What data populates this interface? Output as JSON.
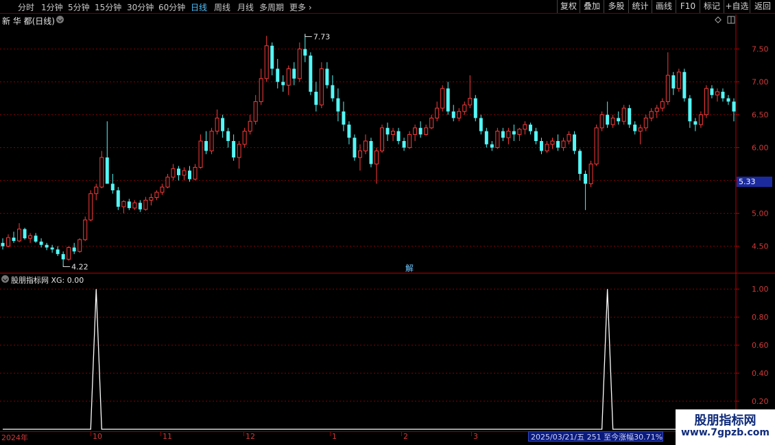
{
  "toolbar": {
    "tabs": [
      "分时",
      "1分钟",
      "5分钟",
      "15分钟",
      "30分钟",
      "60分钟",
      "日线",
      "周线",
      "月线",
      "多周期",
      "更多"
    ],
    "right_buttons": [
      "复权",
      "叠加",
      "多股",
      "统计",
      "画线",
      "F10",
      "标记",
      "+自选",
      "返回"
    ]
  },
  "stock": {
    "title": "新 华 都(日线)"
  },
  "main_chart": {
    "high_label": "7.73",
    "low_label": "4.22",
    "current_price": "5.33",
    "marker": "解",
    "y_ticks": [
      "7.50",
      "7.00",
      "6.50",
      "6.00",
      "5.50",
      "5.00",
      "4.50"
    ]
  },
  "indicator": {
    "title": "股朋指标网 XG: 0.00",
    "y_ticks": [
      "1.00",
      "0.80",
      "0.60",
      "0.40",
      "0.20"
    ]
  },
  "x_axis": {
    "ticks": [
      "2024年",
      "10",
      "11",
      "12",
      "1",
      "2",
      "3"
    ]
  },
  "status_bar": {
    "text": "2025/03/21/五 251 至今涨幅30.71%"
  },
  "watermark": {
    "title": "股朋指标网",
    "url": "www.7gpzb.com"
  },
  "colors": {
    "up": "#ff3b3b",
    "down": "#54f7f7",
    "grid": "#8b0000",
    "axis": "#c00000"
  },
  "chart_data": {
    "type": "candlestick",
    "title": "新 华 都(日线)",
    "y_range": [
      4.1,
      7.85
    ],
    "ohlc": [
      [
        4.55,
        4.62,
        4.45,
        4.5
      ],
      [
        4.5,
        4.68,
        4.48,
        4.63
      ],
      [
        4.63,
        4.72,
        4.55,
        4.58
      ],
      [
        4.58,
        4.85,
        4.56,
        4.76
      ],
      [
        4.76,
        4.78,
        4.6,
        4.62
      ],
      [
        4.62,
        4.7,
        4.55,
        4.66
      ],
      [
        4.66,
        4.7,
        4.55,
        4.57
      ],
      [
        4.57,
        4.62,
        4.48,
        4.52
      ],
      [
        4.52,
        4.55,
        4.44,
        4.48
      ],
      [
        4.48,
        4.52,
        4.4,
        4.45
      ],
      [
        4.45,
        4.5,
        4.35,
        4.38
      ],
      [
        4.38,
        4.42,
        4.22,
        4.3
      ],
      [
        4.3,
        4.5,
        4.28,
        4.48
      ],
      [
        4.48,
        4.55,
        4.38,
        4.42
      ],
      [
        4.42,
        4.62,
        4.4,
        4.6
      ],
      [
        4.6,
        4.95,
        4.58,
        4.9
      ],
      [
        4.9,
        5.35,
        4.88,
        5.3
      ],
      [
        5.3,
        5.45,
        5.2,
        5.4
      ],
      [
        5.4,
        5.95,
        5.38,
        5.85
      ],
      [
        5.85,
        6.4,
        5.78,
        5.45
      ],
      [
        5.45,
        5.6,
        5.3,
        5.35
      ],
      [
        5.35,
        5.4,
        5.05,
        5.1
      ],
      [
        5.1,
        5.2,
        5.0,
        5.18
      ],
      [
        5.18,
        5.22,
        5.05,
        5.08
      ],
      [
        5.08,
        5.2,
        5.05,
        5.16
      ],
      [
        5.16,
        5.2,
        5.02,
        5.06
      ],
      [
        5.06,
        5.25,
        5.04,
        5.2
      ],
      [
        5.2,
        5.3,
        5.12,
        5.24
      ],
      [
        5.24,
        5.35,
        5.2,
        5.32
      ],
      [
        5.32,
        5.45,
        5.28,
        5.4
      ],
      [
        5.4,
        5.6,
        5.38,
        5.55
      ],
      [
        5.55,
        5.75,
        5.5,
        5.68
      ],
      [
        5.68,
        5.72,
        5.5,
        5.58
      ],
      [
        5.58,
        5.7,
        5.5,
        5.65
      ],
      [
        5.65,
        5.72,
        5.48,
        5.52
      ],
      [
        5.52,
        5.75,
        5.5,
        5.7
      ],
      [
        5.7,
        6.2,
        5.68,
        6.1
      ],
      [
        6.1,
        6.25,
        5.9,
        5.95
      ],
      [
        5.95,
        6.3,
        5.9,
        6.25
      ],
      [
        6.25,
        6.58,
        6.2,
        6.45
      ],
      [
        6.45,
        6.5,
        6.15,
        6.25
      ],
      [
        6.25,
        6.3,
        6.0,
        6.1
      ],
      [
        6.1,
        6.2,
        5.8,
        5.85
      ],
      [
        5.85,
        6.1,
        5.68,
        6.05
      ],
      [
        6.05,
        6.3,
        6.0,
        6.25
      ],
      [
        6.25,
        6.5,
        6.2,
        6.4
      ],
      [
        6.4,
        6.8,
        6.35,
        6.7
      ],
      [
        6.7,
        7.2,
        6.65,
        7.05
      ],
      [
        7.05,
        7.7,
        7.0,
        7.55
      ],
      [
        7.55,
        7.6,
        7.1,
        7.2
      ],
      [
        7.2,
        7.35,
        6.9,
        7.0
      ],
      [
        7.0,
        7.1,
        6.85,
        6.95
      ],
      [
        6.95,
        7.25,
        6.8,
        7.2
      ],
      [
        7.2,
        7.3,
        6.95,
        7.05
      ],
      [
        7.05,
        7.6,
        7.0,
        7.5
      ],
      [
        7.5,
        7.73,
        7.3,
        7.4
      ],
      [
        7.4,
        7.45,
        6.8,
        6.85
      ],
      [
        6.85,
        7.0,
        6.55,
        6.65
      ],
      [
        6.65,
        7.3,
        6.6,
        7.2
      ],
      [
        7.2,
        7.3,
        6.9,
        6.95
      ],
      [
        6.95,
        7.1,
        6.7,
        6.75
      ],
      [
        6.75,
        6.9,
        6.4,
        6.55
      ],
      [
        6.55,
        6.7,
        6.25,
        6.35
      ],
      [
        6.35,
        6.4,
        6.05,
        6.15
      ],
      [
        6.15,
        6.2,
        5.8,
        5.85
      ],
      [
        5.85,
        6.05,
        5.65,
        5.95
      ],
      [
        5.95,
        6.2,
        5.9,
        6.1
      ],
      [
        6.1,
        6.15,
        5.7,
        5.75
      ],
      [
        5.75,
        6.0,
        5.45,
        5.95
      ],
      [
        5.95,
        6.35,
        5.92,
        6.3
      ],
      [
        6.3,
        6.38,
        6.1,
        6.2
      ],
      [
        6.2,
        6.3,
        6.1,
        6.25
      ],
      [
        6.25,
        6.3,
        6.05,
        6.1
      ],
      [
        6.1,
        6.15,
        5.95,
        6.0
      ],
      [
        6.0,
        6.25,
        5.98,
        6.2
      ],
      [
        6.2,
        6.35,
        6.1,
        6.3
      ],
      [
        6.3,
        6.4,
        6.15,
        6.2
      ],
      [
        6.2,
        6.35,
        6.18,
        6.3
      ],
      [
        6.3,
        6.5,
        6.28,
        6.45
      ],
      [
        6.45,
        6.7,
        6.4,
        6.6
      ],
      [
        6.6,
        6.95,
        6.55,
        6.9
      ],
      [
        6.9,
        7.0,
        6.5,
        6.55
      ],
      [
        6.55,
        6.65,
        6.4,
        6.45
      ],
      [
        6.45,
        6.6,
        6.4,
        6.55
      ],
      [
        6.55,
        6.7,
        6.5,
        6.65
      ],
      [
        6.65,
        7.1,
        6.6,
        6.75
      ],
      [
        6.75,
        6.8,
        6.4,
        6.45
      ],
      [
        6.45,
        6.5,
        6.2,
        6.25
      ],
      [
        6.25,
        6.3,
        6.0,
        6.05
      ],
      [
        6.05,
        6.1,
        5.95,
        6.0
      ],
      [
        6.0,
        6.3,
        5.98,
        6.25
      ],
      [
        6.25,
        6.3,
        6.1,
        6.15
      ],
      [
        6.15,
        6.3,
        6.05,
        6.25
      ],
      [
        6.25,
        6.35,
        6.1,
        6.2
      ],
      [
        6.2,
        6.3,
        6.1,
        6.28
      ],
      [
        6.28,
        6.4,
        6.2,
        6.35
      ],
      [
        6.35,
        6.38,
        6.2,
        6.25
      ],
      [
        6.25,
        6.3,
        6.05,
        6.1
      ],
      [
        6.1,
        6.15,
        5.9,
        5.95
      ],
      [
        5.95,
        6.1,
        5.92,
        6.05
      ],
      [
        6.05,
        6.15,
        5.98,
        6.1
      ],
      [
        6.1,
        6.2,
        5.95,
        6.0
      ],
      [
        6.0,
        6.15,
        5.95,
        6.1
      ],
      [
        6.1,
        6.25,
        6.05,
        6.2
      ],
      [
        6.2,
        6.25,
        5.9,
        5.95
      ],
      [
        5.95,
        5.98,
        5.5,
        5.6
      ],
      [
        5.6,
        5.65,
        5.05,
        5.45
      ],
      [
        5.45,
        5.8,
        5.4,
        5.75
      ],
      [
        5.75,
        6.35,
        5.72,
        6.3
      ],
      [
        6.3,
        6.55,
        6.25,
        6.5
      ],
      [
        6.5,
        6.7,
        6.3,
        6.35
      ],
      [
        6.35,
        6.5,
        6.3,
        6.45
      ],
      [
        6.45,
        6.55,
        6.35,
        6.4
      ],
      [
        6.4,
        6.65,
        6.35,
        6.6
      ],
      [
        6.6,
        6.65,
        6.3,
        6.35
      ],
      [
        6.35,
        6.4,
        6.2,
        6.25
      ],
      [
        6.25,
        6.35,
        6.05,
        6.3
      ],
      [
        6.3,
        6.5,
        6.25,
        6.45
      ],
      [
        6.45,
        6.6,
        6.4,
        6.55
      ],
      [
        6.55,
        6.65,
        6.45,
        6.6
      ],
      [
        6.6,
        6.75,
        6.55,
        6.7
      ],
      [
        6.7,
        7.45,
        6.65,
        7.1
      ],
      [
        7.1,
        7.15,
        6.8,
        6.9
      ],
      [
        6.9,
        7.2,
        6.85,
        7.15
      ],
      [
        7.15,
        7.2,
        6.7,
        6.75
      ],
      [
        6.75,
        6.8,
        6.3,
        6.4
      ],
      [
        6.4,
        6.45,
        6.25,
        6.35
      ],
      [
        6.35,
        6.55,
        6.3,
        6.5
      ],
      [
        6.5,
        6.95,
        6.45,
        6.9
      ],
      [
        6.9,
        6.95,
        6.75,
        6.8
      ],
      [
        6.8,
        6.9,
        6.7,
        6.85
      ],
      [
        6.85,
        6.9,
        6.7,
        6.75
      ],
      [
        6.75,
        6.8,
        6.65,
        6.7
      ],
      [
        6.7,
        6.75,
        6.4,
        6.55
      ]
    ],
    "indicator": {
      "name": "XG",
      "peaks_at_index": [
        17,
        110
      ],
      "peak_value": 1.0,
      "y_range": [
        0,
        1.05
      ]
    }
  }
}
